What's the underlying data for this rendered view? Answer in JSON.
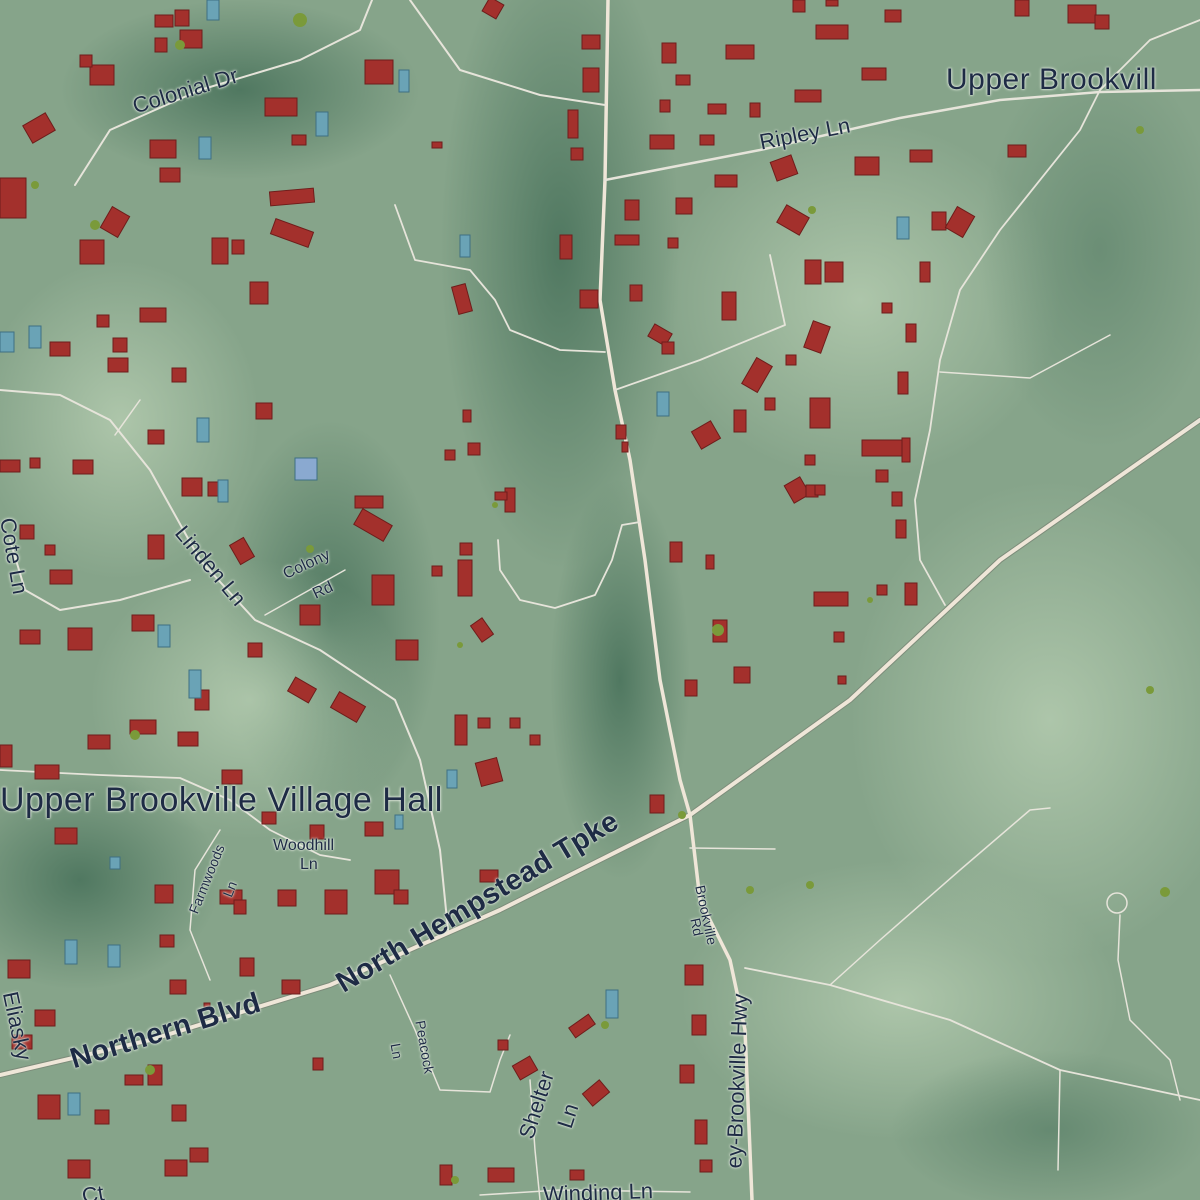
{
  "map": {
    "colors": {
      "terrain": "#86a48a",
      "valley": "#4f7a62",
      "ridge": "#a9c3a6",
      "road_major": "#efe6d8",
      "road_minor": "#e6e4da",
      "building": "#a3302c",
      "building_edge": "#6e1d1b",
      "pool": "#6aa3b6",
      "tree": "#7a9a3a",
      "label": "#1e2b45"
    },
    "labels": {
      "village_hall": "Upper Brookville Village Hall",
      "upper_brookville": "Upper Brookvill",
      "colonial_dr": "Colonial Dr",
      "ripley_ln": "Ripley Ln",
      "linden_ln": "Linden Ln",
      "colony_rd_1": "Colony",
      "colony_rd_2": "Rd",
      "cote_ln": "Cote Ln",
      "north_hempstead_tpke": "North Hempstead Tpke",
      "northern_blvd": "Northern Blvd",
      "farmwoods_ln_1": "Farmwoods",
      "farmwoods_ln_2": "Ln",
      "woodhill_ln_1": "Woodhill",
      "woodhill_ln_2": "Ln",
      "brookville_rd_1": "Brookville",
      "brookville_rd_2": "Rd",
      "brookville_hwy": "ey-Brookville Hwy",
      "peacock_ln_1": "Peacock",
      "peacock_ln_2": "Ln",
      "shelter_ln_1": "Shelter",
      "shelter_ln_2": "Ln",
      "winding_ln": "Winding Ln",
      "eliasky": "Eliasky",
      "ct": "Ct"
    }
  }
}
